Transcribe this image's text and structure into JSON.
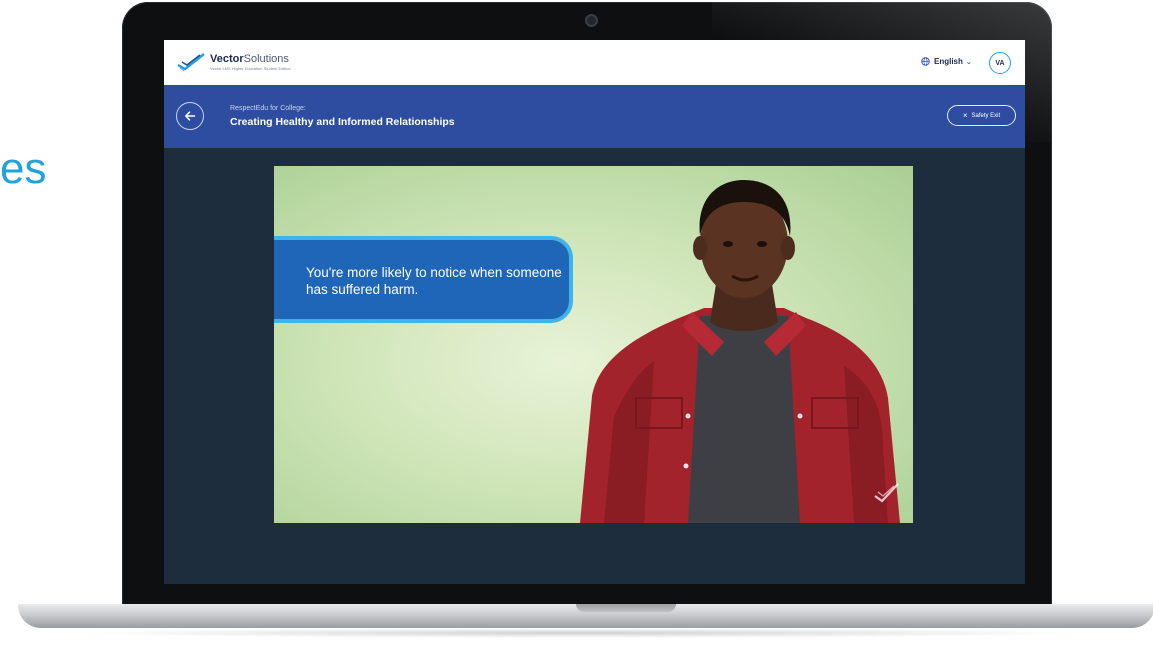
{
  "page": {
    "side_text": "es"
  },
  "app": {
    "logo_name_bold": "Vector",
    "logo_name_light": "Solutions",
    "logo_subtitle": "Vector LMS Higher Education Student Edition",
    "language": "English",
    "avatar_initials": "VA"
  },
  "course": {
    "subtitle": "RespectEdu for College:",
    "title": "Creating Healthy and Informed Relationships",
    "safety_exit": "Safety Exit"
  },
  "video": {
    "caption": "You're more likely to notice when someone has suffered harm."
  },
  "icons": [
    "globe-icon",
    "chevron-down-icon",
    "arrow-left-icon",
    "close-icon",
    "vector-solutions-logo-icon",
    "watermark-logo-icon"
  ],
  "colors": {
    "header_blue": "#2f4da0",
    "bubble_blue": "#1f66b8",
    "bubble_border": "#3fb3ea",
    "screen_bg": "#1e2d3d",
    "accent": "#1fa3dc"
  }
}
